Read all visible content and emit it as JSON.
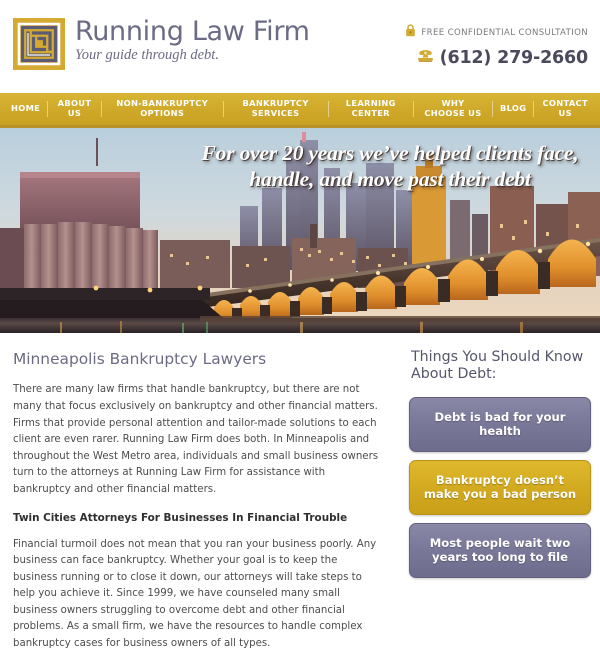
{
  "header": {
    "brand_name": "Running Law Firm",
    "tagline": "Your guide through debt.",
    "logo_icon": "maze-logo-icon",
    "lock_icon": "lock-icon",
    "consultation_text": "FREE CONFIDENTIAL CONSULTATION",
    "phone_icon": "phone-icon",
    "phone_number": "(612) 279-2660"
  },
  "nav": {
    "items": [
      {
        "label": "HOME"
      },
      {
        "label": "ABOUT US"
      },
      {
        "label": "NON-BANKRUPTCY OPTIONS"
      },
      {
        "label": "BANKRUPTCY SERVICES"
      },
      {
        "label": "LEARNING CENTER"
      },
      {
        "label": "WHY CHOOSE US"
      },
      {
        "label": "BLOG"
      },
      {
        "label": "CONTACT US"
      }
    ]
  },
  "hero": {
    "headline": "For over 20 years we’ve helped clients face, handle, and move past their debt",
    "image_description": "Minneapolis skyline at dusk with the Stone Arch Bridge"
  },
  "main": {
    "title": "Minneapolis Bankruptcy Lawyers",
    "paragraph_1": "There are many law firms that handle bankruptcy, but there are not many that focus exclusively on bankruptcy and other financial matters. Firms that provide personal attention and tailor-made solutions to each client are even rarer. Running Law Firm does both. In Minneapolis and throughout the West Metro area, individuals and small business owners turn to the attorneys at Running Law Firm for assistance with bankruptcy and other financial matters.",
    "subheading": "Twin Cities Attorneys For Businesses In Financial Trouble",
    "paragraph_2": "Financial turmoil does not mean that you ran your business poorly. Any business can face bankruptcy. Whether your goal is to keep the business running or to close it down, our attorneys will take steps to help you achieve it. Since 1999, we have counseled many small business owners struggling to overcome debt and other financial problems. As a small firm, we have the resources to handle complex bankruptcy cases for business owners of all types."
  },
  "sidebar": {
    "title": "Things You Should Know About Debt:",
    "facts": [
      {
        "label": "Debt is bad for your health",
        "style": "purple"
      },
      {
        "label": "Bankruptcy doesn’t make you a bad person",
        "style": "gold"
      },
      {
        "label": "Most people wait two years too long to file",
        "style": "purple"
      }
    ]
  },
  "colors": {
    "gold": "#cfa829",
    "gold_dark": "#b8922a",
    "purple": "#7b799a",
    "brand_text": "#6b6b86",
    "body_text": "#4d4d4d"
  }
}
